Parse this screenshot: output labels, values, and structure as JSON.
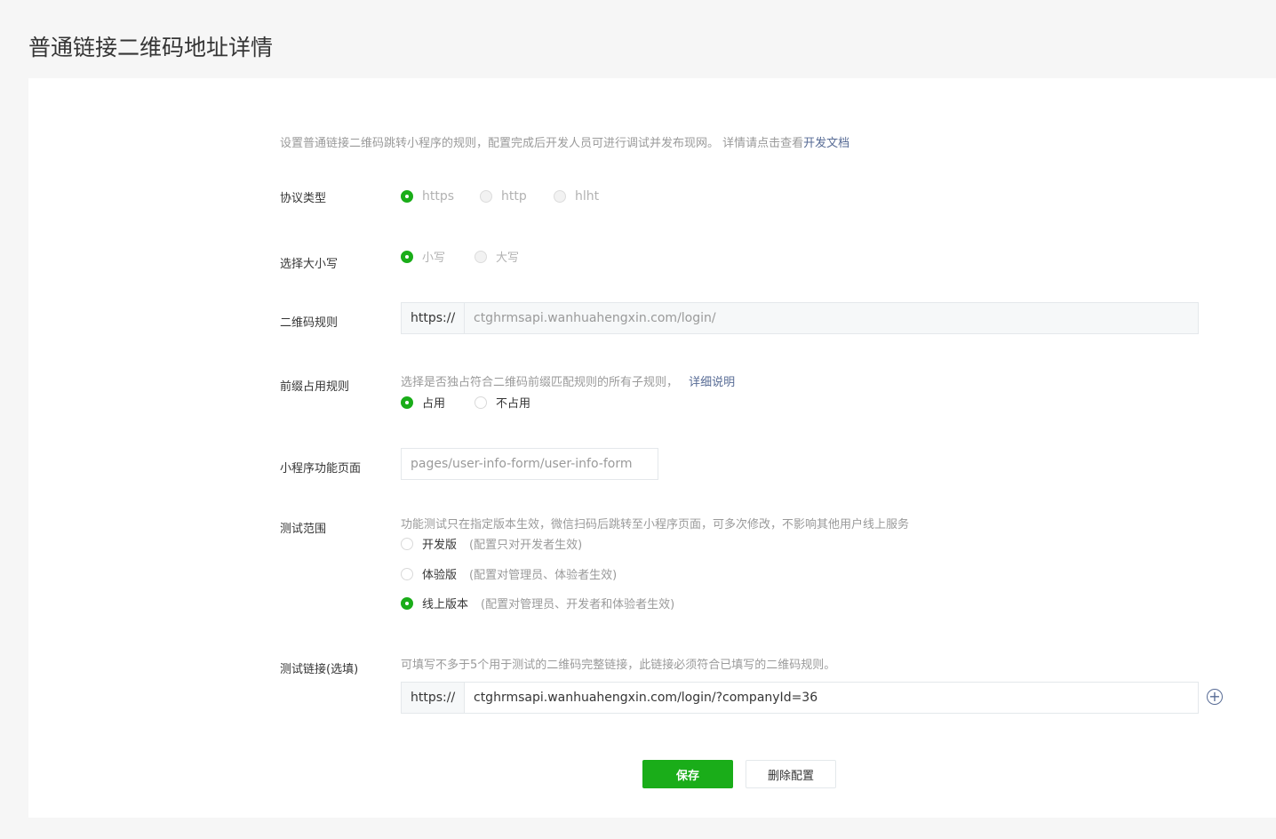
{
  "page_title": "普通链接二维码地址详情",
  "description": {
    "text": "设置普通链接二维码跳转小程序的规则，配置完成后开发人员可进行调试并发布现网。 详情请点击查看",
    "link": "开发文档"
  },
  "protocol": {
    "label": "协议类型",
    "options": [
      "https",
      "http",
      "hlht"
    ],
    "selected": "https"
  },
  "case": {
    "label": "选择大小写",
    "options": [
      "小写",
      "大写"
    ],
    "selected": "小写"
  },
  "qr_rule": {
    "label": "二维码规则",
    "prefix": "https://",
    "value": "ctghrmsapi.wanhuahengxin.com/login/"
  },
  "prefix_rule": {
    "label": "前缀占用规则",
    "hint": "选择是否独占符合二维码前缀匹配规则的所有子规则，",
    "hint_link": "详细说明",
    "options": [
      "占用",
      "不占用"
    ],
    "selected": "占用"
  },
  "page_path": {
    "label": "小程序功能页面",
    "value": "pages/user-info-form/user-info-form"
  },
  "test_scope": {
    "label": "测试范围",
    "hint": "功能测试只在指定版本生效，微信扫码后跳转至小程序页面，可多次修改，不影响其他用户线上服务",
    "options": [
      {
        "label": "开发版",
        "note": "(配置只对开发者生效)"
      },
      {
        "label": "体验版",
        "note": "(配置对管理员、体验者生效)"
      },
      {
        "label": "线上版本",
        "note": "(配置对管理员、开发者和体验者生效)"
      }
    ],
    "selected": "线上版本"
  },
  "test_link": {
    "label": "测试链接(选填)",
    "hint": "可填写不多于5个用于测试的二维码完整链接，此链接必须符合已填写的二维码规则。",
    "prefix": "https://",
    "value": "ctghrmsapi.wanhuahengxin.com/login/?companyId=36",
    "add_icon": "plus-circle-icon"
  },
  "buttons": {
    "save": "保存",
    "delete": "删除配置"
  },
  "colors": {
    "accent": "#1aad19",
    "link": "#576b95"
  }
}
